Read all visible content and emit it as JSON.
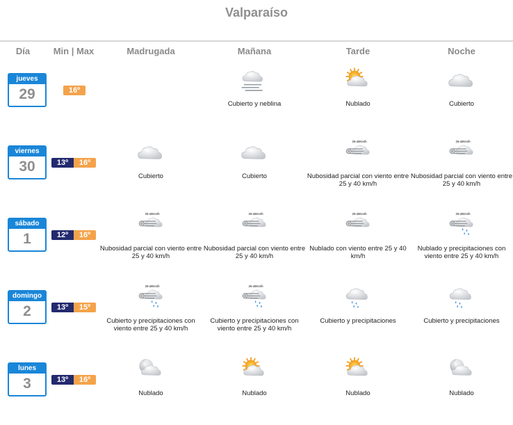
{
  "title": "Valparaíso",
  "headers": {
    "dia": "Día",
    "minmax": "Min | Max",
    "madrugada": "Madrugada",
    "manana": "Mañana",
    "tarde": "Tarde",
    "noche": "Noche"
  },
  "wind_badge": "25-40Km/h",
  "colors": {
    "calendar": "#1a86d8",
    "min": "#232a6e",
    "max": "#f4a34b",
    "text_gray": "#8f8f8f"
  },
  "days": [
    {
      "name": "jueves",
      "date": "29",
      "min": "",
      "max": "16º",
      "periods": [
        null,
        {
          "icon": "fog-cloud-icon",
          "desc": "Cubierto y neblina"
        },
        {
          "icon": "sun-cloud-icon",
          "desc": "Nublado"
        },
        {
          "icon": "cloud-icon",
          "desc": "Cubierto"
        }
      ]
    },
    {
      "name": "viernes",
      "date": "30",
      "min": "13º",
      "max": "16º",
      "periods": [
        {
          "icon": "cloud-icon",
          "desc": "Cubierto"
        },
        {
          "icon": "cloud-icon",
          "desc": "Cubierto"
        },
        {
          "icon": "wind-icon",
          "desc": "Nubosidad parcial con viento entre 25 y 40 km/h"
        },
        {
          "icon": "wind-icon",
          "desc": "Nubosidad parcial con viento entre 25 y 40 km/h"
        }
      ]
    },
    {
      "name": "sábado",
      "date": "1",
      "min": "12º",
      "max": "16º",
      "periods": [
        {
          "icon": "wind-icon",
          "desc": "Nubosidad parcial con viento entre 25 y 40 km/h"
        },
        {
          "icon": "wind-icon",
          "desc": "Nubosidad parcial con viento entre 25 y 40 km/h"
        },
        {
          "icon": "wind-icon",
          "desc": "Nublado con viento entre 25 y 40 km/h"
        },
        {
          "icon": "wind-rain-icon",
          "desc": "Nublado y precipitaciones con viento entre 25 y 40 km/h"
        }
      ]
    },
    {
      "name": "domingo",
      "date": "2",
      "min": "13º",
      "max": "15º",
      "periods": [
        {
          "icon": "wind-rain-icon",
          "desc": "Cubierto y precipitaciones con viento entre 25 y 40 km/h"
        },
        {
          "icon": "wind-rain-icon",
          "desc": "Cubierto y precipitaciones con viento entre 25 y 40 km/h"
        },
        {
          "icon": "rain-cloud-icon",
          "desc": "Cubierto y precipitaciones"
        },
        {
          "icon": "rain-cloud-icon",
          "desc": "Cubierto y precipitaciones"
        }
      ]
    },
    {
      "name": "lunes",
      "date": "3",
      "min": "13º",
      "max": "16º",
      "periods": [
        {
          "icon": "moon-cloud-icon",
          "desc": "Nublado"
        },
        {
          "icon": "sun-cloud-icon",
          "desc": "Nublado"
        },
        {
          "icon": "sun-cloud-icon",
          "desc": "Nublado"
        },
        {
          "icon": "moon-cloud-icon",
          "desc": "Nublado"
        }
      ]
    }
  ]
}
